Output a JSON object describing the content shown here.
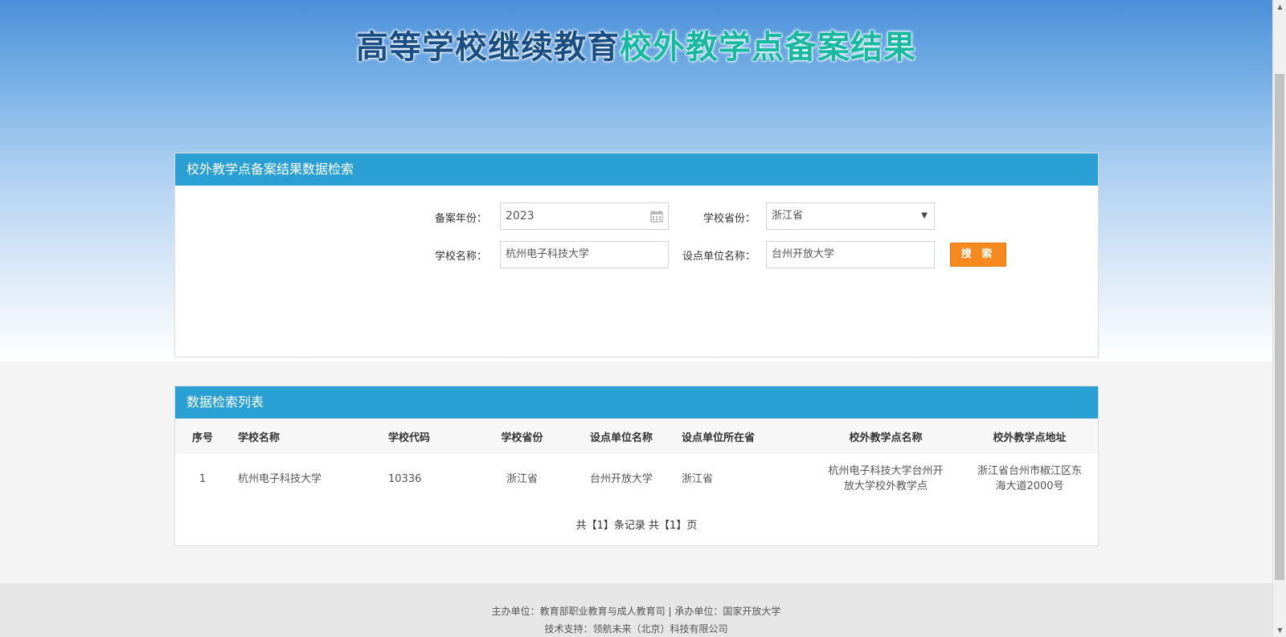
{
  "header": {
    "title_part1": "高等学校继续教育",
    "title_part2": "校外教学点备案结果"
  },
  "search": {
    "panel_title": "校外教学点备案结果数据检索",
    "year_label": "备案年份：",
    "year_value": "2023",
    "province_label": "学校省份：",
    "province_value": "浙江省",
    "school_label": "学校名称：",
    "school_value": "杭州电子科技大学",
    "unit_label": "设点单位名称：",
    "unit_value": "台州开放大学",
    "search_button": "搜 索"
  },
  "results": {
    "panel_title": "数据检索列表",
    "columns": [
      "序号",
      "学校名称",
      "学校代码",
      "学校省份",
      "设点单位名称",
      "设点单位所在省",
      "校外教学点名称",
      "校外教学点地址"
    ],
    "rows": [
      [
        "1",
        "杭州电子科技大学",
        "10336",
        "浙江省",
        "台州开放大学",
        "浙江省",
        "杭州电子科技大学台州开放大学校外教学点",
        "浙江省台州市椒江区东海大道2000号"
      ]
    ],
    "pager": "共【1】条记录 共【1】页"
  },
  "footer": {
    "line1": "主办单位：教育部职业教育与成人教育司 | 承办单位：国家开放大学",
    "line2": "技术支持：领航未来（北京）科技有限公司"
  },
  "colors": {
    "header_bar": "#2a9fd4",
    "search_button": "#f78a1e",
    "title_dark": "#1a4f86",
    "title_teal": "#19b8a0"
  }
}
